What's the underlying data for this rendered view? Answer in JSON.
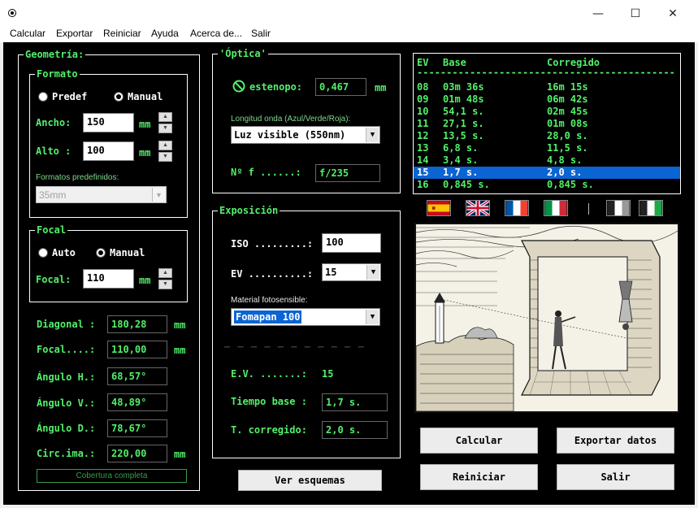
{
  "window": {
    "minimize": "—",
    "maximize": "☐",
    "close": "✕"
  },
  "menu": [
    "Calcular",
    "Exportar",
    "Reiniciar",
    "Ayuda",
    "Acerca de...",
    "Salir"
  ],
  "geometria": {
    "title": "Geometría:",
    "formato": {
      "title": "Formato",
      "radio_predef": "Predef",
      "radio_manual": "Manual",
      "selected": "Manual",
      "ancho_label": "Ancho:",
      "ancho_value": "150",
      "alto_label": "Alto :",
      "alto_value": "100",
      "unit": "mm",
      "predef_label": "Formatos predefinidos:",
      "predef_value": "35mm"
    },
    "focal": {
      "title": "Focal",
      "radio_auto": "Auto",
      "radio_manual": "Manual",
      "selected": "Manual",
      "label": "Focal:",
      "value": "110",
      "unit": "mm"
    },
    "results": [
      {
        "label": "Diagonal :",
        "value": "180,28",
        "unit": "mm"
      },
      {
        "label": "Focal....:",
        "value": "110,00",
        "unit": "mm"
      },
      {
        "label": "Ángulo H.:",
        "value": "68,57°",
        "unit": ""
      },
      {
        "label": "Ángulo V.:",
        "value": "48,89°",
        "unit": ""
      },
      {
        "label": "Ángulo D.:",
        "value": "78,67°",
        "unit": ""
      },
      {
        "label": "Circ.ima.:",
        "value": "220,00",
        "unit": "mm"
      }
    ],
    "cobertura": "Cobertura completa"
  },
  "optica": {
    "title": "'Óptica'",
    "estenopo_label": "estenopo:",
    "estenopo_value": "0,467",
    "unit": "mm",
    "longitud_label": "Longitud onda (Azul/Verde/Roja):",
    "longitud_value": "Luz visible (550nm)",
    "nf_label": "Nº f ......:",
    "nf_value": "f/235"
  },
  "exposicion": {
    "title": "Exposición",
    "iso_label": "ISO .........:",
    "iso_value": "100",
    "ev_label": "EV ..........:",
    "ev_value": "15",
    "material_label": "Material fotosensible:",
    "material_value": "Fomapan 100",
    "separator": "— — — — — — — — — — —",
    "ev_result_label": "E.V. .......:",
    "ev_result_value": "15",
    "tiempo_label": "Tiempo base :",
    "tiempo_value": "1,7 s.",
    "tcorr_label": "T. corregido:",
    "tcorr_value": "2,0 s."
  },
  "ev_table": {
    "headers": [
      "EV",
      "Base",
      "Corregido"
    ],
    "divider": "--------------------------------------------",
    "rows": [
      [
        "08",
        "03m 36s",
        "16m 15s"
      ],
      [
        "09",
        "01m 48s",
        "06m 42s"
      ],
      [
        "10",
        "54,1 s.",
        "02m 45s"
      ],
      [
        "11",
        "27,1 s.",
        "01m 08s"
      ],
      [
        "12",
        "13,5 s.",
        "28,0 s."
      ],
      [
        "13",
        "6,8 s.",
        "11,5 s."
      ],
      [
        "14",
        "3,4 s.",
        "4,8 s."
      ],
      [
        "15",
        "1,7 s.",
        "2,0 s."
      ],
      [
        "16",
        "0,845 s.",
        "0,845 s."
      ]
    ],
    "selected_row": 7
  },
  "flags": [
    "Español",
    "English",
    "Français",
    "Italiano"
  ],
  "buttons": {
    "calcular": "Calcular",
    "exportar": "Exportar datos",
    "reiniciar": "Reiniciar",
    "salir": "Salir",
    "ver_esquemas": "Ver esquemas"
  },
  "colors": {
    "accent_green": "#52f06a",
    "selection_blue": "#0a64d4",
    "background": "#000000"
  }
}
